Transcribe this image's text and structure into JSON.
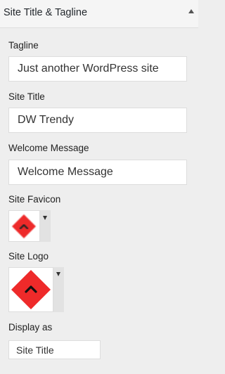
{
  "section": {
    "title": "Site Title & Tagline",
    "toggle_icon": "arrow-up-icon"
  },
  "fields": {
    "tagline": {
      "label": "Tagline",
      "value": "Just another WordPress site"
    },
    "site_title": {
      "label": "Site Title",
      "value": "DW Trendy"
    },
    "welcome_message": {
      "label": "Welcome Message",
      "value": "Welcome Message"
    },
    "site_favicon": {
      "label": "Site Favicon",
      "icon": "red-diamond-chevron-icon",
      "color": "#ee2a2a"
    },
    "site_logo": {
      "label": "Site Logo",
      "icon": "red-diamond-chevron-icon",
      "color": "#ee2a2a"
    },
    "display_as": {
      "label": "Display as",
      "value": "Site Title"
    }
  }
}
